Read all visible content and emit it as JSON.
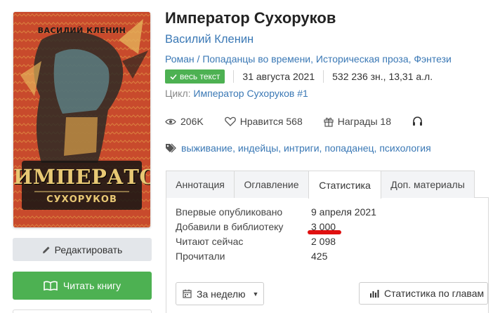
{
  "book": {
    "title": "Император Сухоруков",
    "author": "Василий Кленин",
    "genres": [
      "Роман",
      "Попаданцы во времени",
      "Историческая проза",
      "Фэнтези"
    ],
    "badge_label": "весь текст",
    "date": "31 августа 2021",
    "size": "532 236 зн., 13,31 а.л.",
    "cycle_label": "Цикл:",
    "cycle_value": "Император Сухоруков #1"
  },
  "cover": {
    "author_text": "ВАСИЛИЙ КЛЕНИН",
    "title_text": "ИМПЕРАТОР",
    "subtitle_text": "СУХОРУКОВ"
  },
  "stats": {
    "views": "206K",
    "likes": "Нравится 568",
    "awards": "Награды 18"
  },
  "tags": "выживание, индейцы, интриги, попаданец, психология",
  "tabs": [
    "Аннотация",
    "Оглавление",
    "Статистика",
    "Доп. материалы"
  ],
  "statistics": [
    {
      "label": "Впервые опубликовано",
      "value": "9 апреля 2021"
    },
    {
      "label": "Добавили в библиотеку",
      "value": "3 000"
    },
    {
      "label": "Читают сейчас",
      "value": "2 098"
    },
    {
      "label": "Прочитали",
      "value": "425"
    }
  ],
  "controls": {
    "period": "За неделю",
    "by_chapters": "Статистика по главам"
  },
  "buttons": {
    "edit": "Редактировать",
    "read": "Читать книгу"
  },
  "colors": {
    "accent_green": "#4db152",
    "link_blue": "#3a78b5",
    "highlight_red": "#e01010"
  }
}
